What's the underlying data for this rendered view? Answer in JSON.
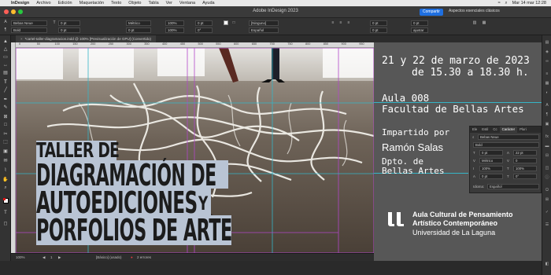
{
  "menubar": {
    "app": "InDesign",
    "items": [
      "Archivo",
      "Edición",
      "Maquetación",
      "Texto",
      "Objeto",
      "Tabla",
      "Ver",
      "Ventana",
      "Ayuda"
    ],
    "clock": "Mar 14 mar  12:28"
  },
  "window": {
    "title": "Adobe InDesign 2023",
    "share_label": "Compartir",
    "workspace_label": "Aspectos esenciales clásicos"
  },
  "controlbar": {
    "font_family": "Bebas Neue",
    "font_style": "Bold",
    "kerning": "Métrico",
    "size": "0 pt",
    "vscale": "100%",
    "hscale": "100%",
    "baseline": "0 pt",
    "skew": "0°",
    "char_style": "[Ninguno]",
    "language": "Español",
    "tracking": "0 pt",
    "justify": "ajustar"
  },
  "document": {
    "tab_label": "*cartel-taller-diagramacion.indd @ 100% [Previsualización de GPU] (Convertido)",
    "zoom": "100%",
    "page": "1",
    "style": "[Básico] (usado)",
    "errors": "2 errores"
  },
  "ruler_ticks": [
    "0",
    "50",
    "100",
    "150",
    "200",
    "250",
    "300",
    "350",
    "400",
    "450",
    "500",
    "550",
    "600",
    "650",
    "700",
    "750",
    "800",
    "850",
    "900",
    "950"
  ],
  "poster": {
    "title_line1": "TALLER DE",
    "title_line2": "DIAGRAMACIÓN DE",
    "title_line3": "AUTOEDICIONES",
    "title_line3b": "Y",
    "title_line4": "PORFOLIOS DE ARTE",
    "dates": "21 y 22 de marzo de 2023",
    "hours": "de 15.30 a 18.30 h.",
    "room": "Aula 008",
    "faculty": "Facultad de Bellas Artes",
    "taught_by": "Impartido por",
    "teacher": "Ramón Salas",
    "dept_line1": "Dpto. de",
    "dept_line2": "Bellas Artes",
    "logo_line1": "Aula Cultural de Pensamiento",
    "logo_line2": "Artístico Contemporáneo",
    "logo_line3": "Universidad de La Laguna"
  },
  "char_panel": {
    "tabs": [
      "Ele",
      "Estil",
      "Cc",
      "Carácter",
      "Pluri"
    ],
    "font_family": "Bebas Neue",
    "font_style": "Bold",
    "size_field": "0 pt",
    "leading_field": "22 pt",
    "kerning_field": "Métrico",
    "tracking_field": "0",
    "vscale_field": "100%",
    "hscale_field": "100%",
    "baseline_field": "0 pt",
    "skew_field": "0°",
    "language_label": "Idioma:",
    "language_value": "Español"
  },
  "colors": {
    "guide_cyan": "#35b5c7",
    "guide_magenta": "#b246c9",
    "share_blue": "#1f6fe0",
    "panel_gray": "#575757",
    "title_highlight": "#b9c4d4"
  }
}
